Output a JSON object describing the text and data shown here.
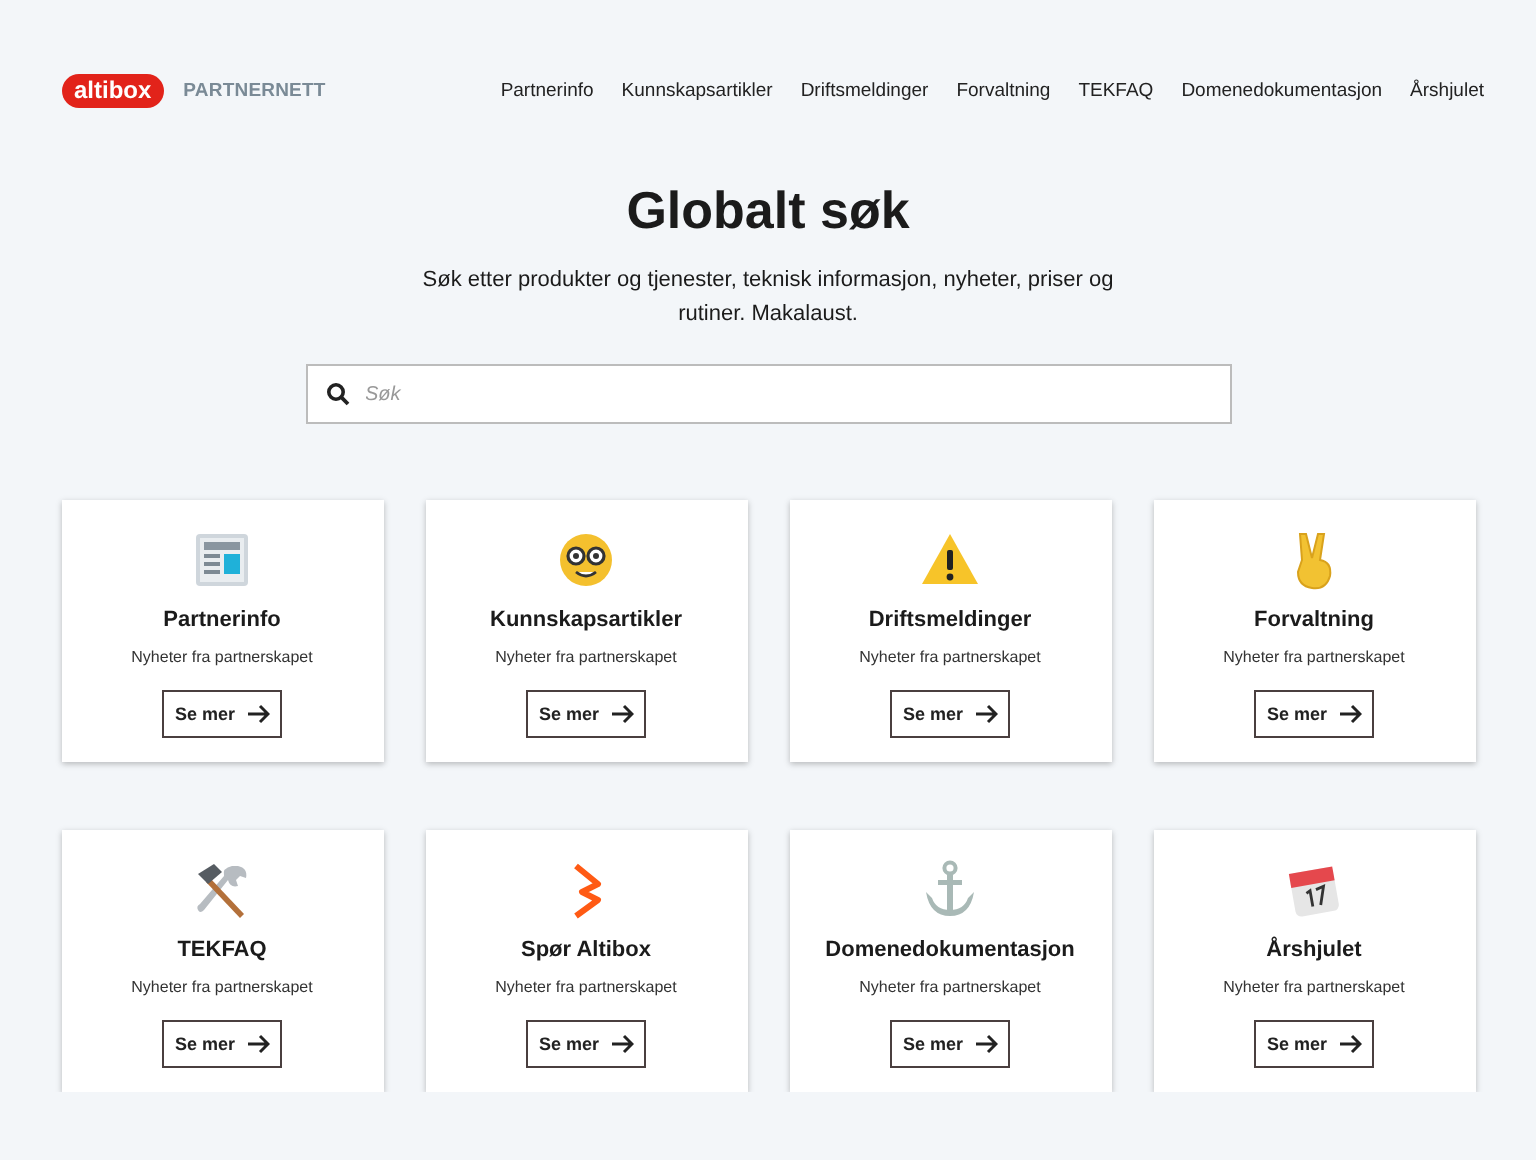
{
  "header": {
    "logo": "altibox",
    "site_name": "PARTNERNETT",
    "nav": [
      "Partnerinfo",
      "Kunnskapsartikler",
      "Driftsmeldinger",
      "Forvaltning",
      "TEKFAQ",
      "Domenedokumentasjon",
      "Årshjulet"
    ]
  },
  "hero": {
    "title": "Globalt søk",
    "subtitle": "Søk etter produkter og tjenester, teknisk informasjon, nyheter, priser og rutiner. Makalaust."
  },
  "search": {
    "placeholder": "Søk"
  },
  "cards": [
    {
      "kind": "news",
      "title": "Partnerinfo",
      "description": "Nyheter fra partnerskapet",
      "button": "Se mer"
    },
    {
      "kind": "nerd",
      "title": "Kunnskapsartikler",
      "description": "Nyheter fra partnerskapet",
      "button": "Se mer"
    },
    {
      "kind": "warning",
      "title": "Driftsmeldinger",
      "description": "Nyheter fra partnerskapet",
      "button": "Se mer"
    },
    {
      "kind": "peace",
      "title": "Forvaltning",
      "description": "Nyheter fra partnerskapet",
      "button": "Se mer"
    },
    {
      "kind": "tools",
      "title": "TEKFAQ",
      "description": "Nyheter fra partnerskapet",
      "button": "Se mer"
    },
    {
      "kind": "brand",
      "title": "Spør Altibox",
      "description": "Nyheter fra partnerskapet",
      "button": "Se mer"
    },
    {
      "kind": "anchor",
      "title": "Domenedokumentasjon",
      "description": "Nyheter fra partnerskapet",
      "button": "Se mer"
    },
    {
      "kind": "calendar",
      "title": "Årshjulet",
      "description": "Nyheter fra partnerskapet",
      "button": "Se mer"
    }
  ]
}
